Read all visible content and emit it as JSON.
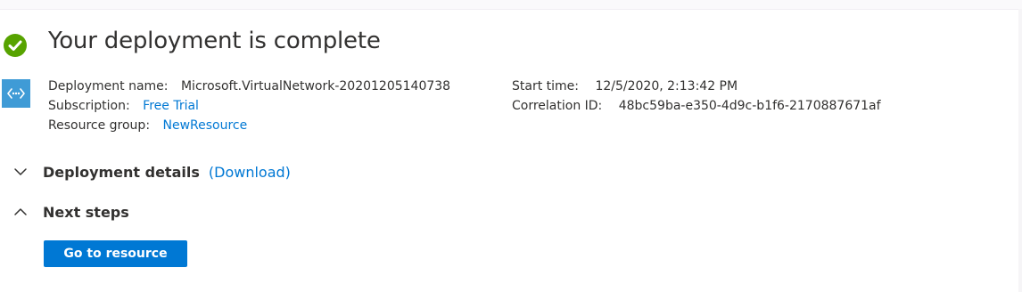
{
  "title": "Your deployment is complete",
  "details": {
    "deployment_name_label": "Deployment name:",
    "deployment_name_value": "Microsoft.VirtualNetwork-20201205140738",
    "subscription_label": "Subscription:",
    "subscription_value": "Free Trial",
    "resource_group_label": "Resource group:",
    "resource_group_value": "NewResource",
    "start_time_label": "Start time:",
    "start_time_value": "12/5/2020, 2:13:42 PM",
    "correlation_id_label": "Correlation ID:",
    "correlation_id_value": "48bc59ba-e350-4d9c-b1f6-2170887671af"
  },
  "sections": {
    "deployment_details": {
      "label": "Deployment details",
      "link": "(Download)",
      "expanded": false
    },
    "next_steps": {
      "label": "Next steps",
      "expanded": true
    }
  },
  "actions": {
    "go_to_resource": "Go to resource"
  },
  "icons": {
    "status": "success-check-icon",
    "resource": "virtual-network-icon"
  },
  "colors": {
    "success": "#57a300",
    "link": "#0078d4",
    "primary_button": "#0078d4",
    "resource_icon": "#3f9bd6"
  }
}
